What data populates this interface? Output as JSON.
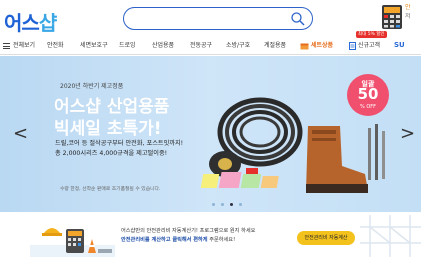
{
  "header": {
    "logo_main": "어스",
    "logo_accent": "샵",
    "search": {
      "placeholder": "",
      "icon": "search-icon"
    },
    "calc_label_1": "안",
    "calc_label_2": "저"
  },
  "nav": {
    "menu_label": "전체보기",
    "items": [
      "안전화",
      "세면보호구",
      "드로잉",
      "산업용품",
      "전동공구",
      "소방/구호",
      "계절용품"
    ],
    "special_label": "세트상품",
    "newbie_label": "신규고객",
    "badge": "최대 5% 할인",
    "su": "SU"
  },
  "banner": {
    "small": "2020년 하반기 제고정품",
    "title1": "어스샵 산업용품",
    "title2": "빅세일 초특가!",
    "desc1": "드릴,코어 등 절삭공구부터 안전화, 포스트잇까지!",
    "desc2": "총 2,000시리즈 4,000규격을 제고떨이중!",
    "note": "수량 한정, 선착순 판매로 조기품절될 수 있습니다.",
    "sale_top": "일괄",
    "sale_num": "50",
    "sale_off": "% OFF",
    "arrow_left": "<",
    "arrow_right": ">",
    "slide_count": 4,
    "active_slide": 3
  },
  "promo": {
    "text1": "어스샵만의 안전관리비 자동계산기! 프로그램으로 원지 하세요",
    "text2_highlight": "안전관리비를 계산하고 클릭해서 편하게",
    "text2_rest": " 주문하세요!",
    "button": "안전관리비 자동계산"
  },
  "colors": {
    "brand_blue": "#1f62d6",
    "accent_light_blue": "#39a7e6",
    "sale_pink": "#f0506e",
    "promo_yellow": "#f4c21d"
  }
}
